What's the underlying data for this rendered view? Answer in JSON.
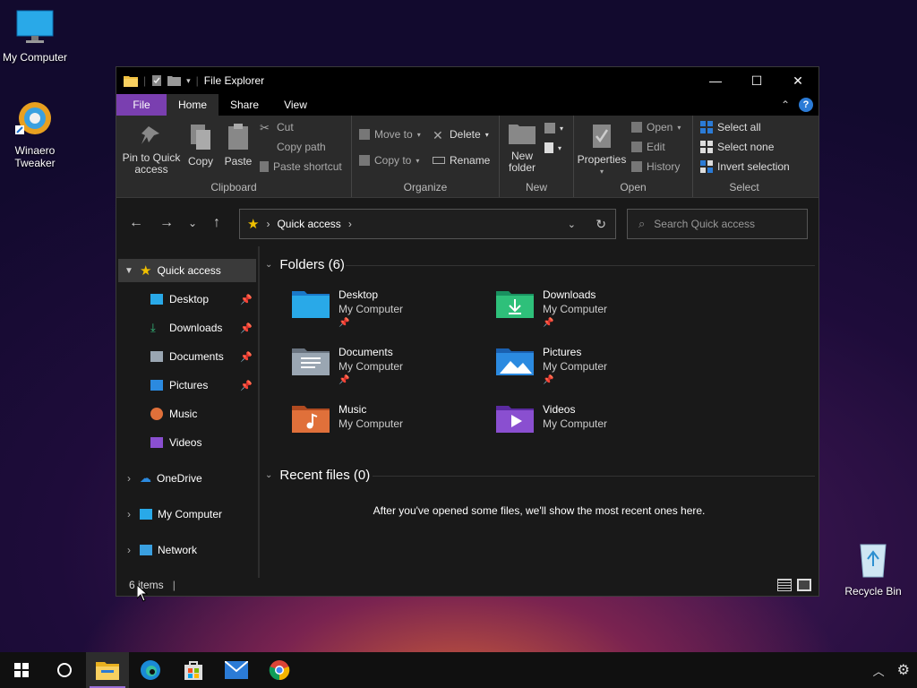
{
  "desktop": {
    "icons": [
      {
        "label": "My Computer"
      },
      {
        "label": "Winaero Tweaker"
      },
      {
        "label": "Recycle Bin"
      }
    ]
  },
  "window": {
    "title": "File Explorer",
    "tabs": [
      "File",
      "Home",
      "Share",
      "View"
    ],
    "ribbon": {
      "clipboard": {
        "label": "Clipboard",
        "pin": "Pin to Quick access",
        "copy": "Copy",
        "paste": "Paste",
        "cut": "Cut",
        "copy_path": "Copy path",
        "paste_shortcut": "Paste shortcut"
      },
      "organize": {
        "label": "Organize",
        "move_to": "Move to",
        "copy_to": "Copy to",
        "delete": "Delete",
        "rename": "Rename"
      },
      "new": {
        "label": "New",
        "new_folder": "New folder"
      },
      "open": {
        "label": "Open",
        "properties": "Properties",
        "open": "Open",
        "edit": "Edit",
        "history": "History"
      },
      "select": {
        "label": "Select",
        "select_all": "Select all",
        "select_none": "Select none",
        "invert": "Invert selection"
      }
    },
    "address": {
      "path": "Quick access",
      "search_placeholder": "Search Quick access"
    },
    "sidebar": {
      "quick_access": "Quick access",
      "items": [
        "Desktop",
        "Downloads",
        "Documents",
        "Pictures",
        "Music",
        "Videos"
      ],
      "onedrive": "OneDrive",
      "my_computer": "My Computer",
      "network": "Network"
    },
    "content": {
      "folders_header": "Folders (6)",
      "folders": [
        {
          "name": "Desktop",
          "location": "My Computer",
          "pinned": true
        },
        {
          "name": "Downloads",
          "location": "My Computer",
          "pinned": true
        },
        {
          "name": "Documents",
          "location": "My Computer",
          "pinned": true
        },
        {
          "name": "Pictures",
          "location": "My Computer",
          "pinned": true
        },
        {
          "name": "Music",
          "location": "My Computer",
          "pinned": false
        },
        {
          "name": "Videos",
          "location": "My Computer",
          "pinned": false
        }
      ],
      "recent_header": "Recent files (0)",
      "recent_empty": "After you've opened some files, we'll show the most recent ones here."
    },
    "status": {
      "items": "6 items"
    },
    "colors": {
      "file_tab": "#7a3fb0",
      "accent": "#9a6fd8"
    }
  },
  "taskbar": {
    "apps": [
      "start-icon",
      "search-icon",
      "file-explorer-icon",
      "edge-icon",
      "store-icon",
      "mail-icon",
      "chrome-icon"
    ]
  }
}
